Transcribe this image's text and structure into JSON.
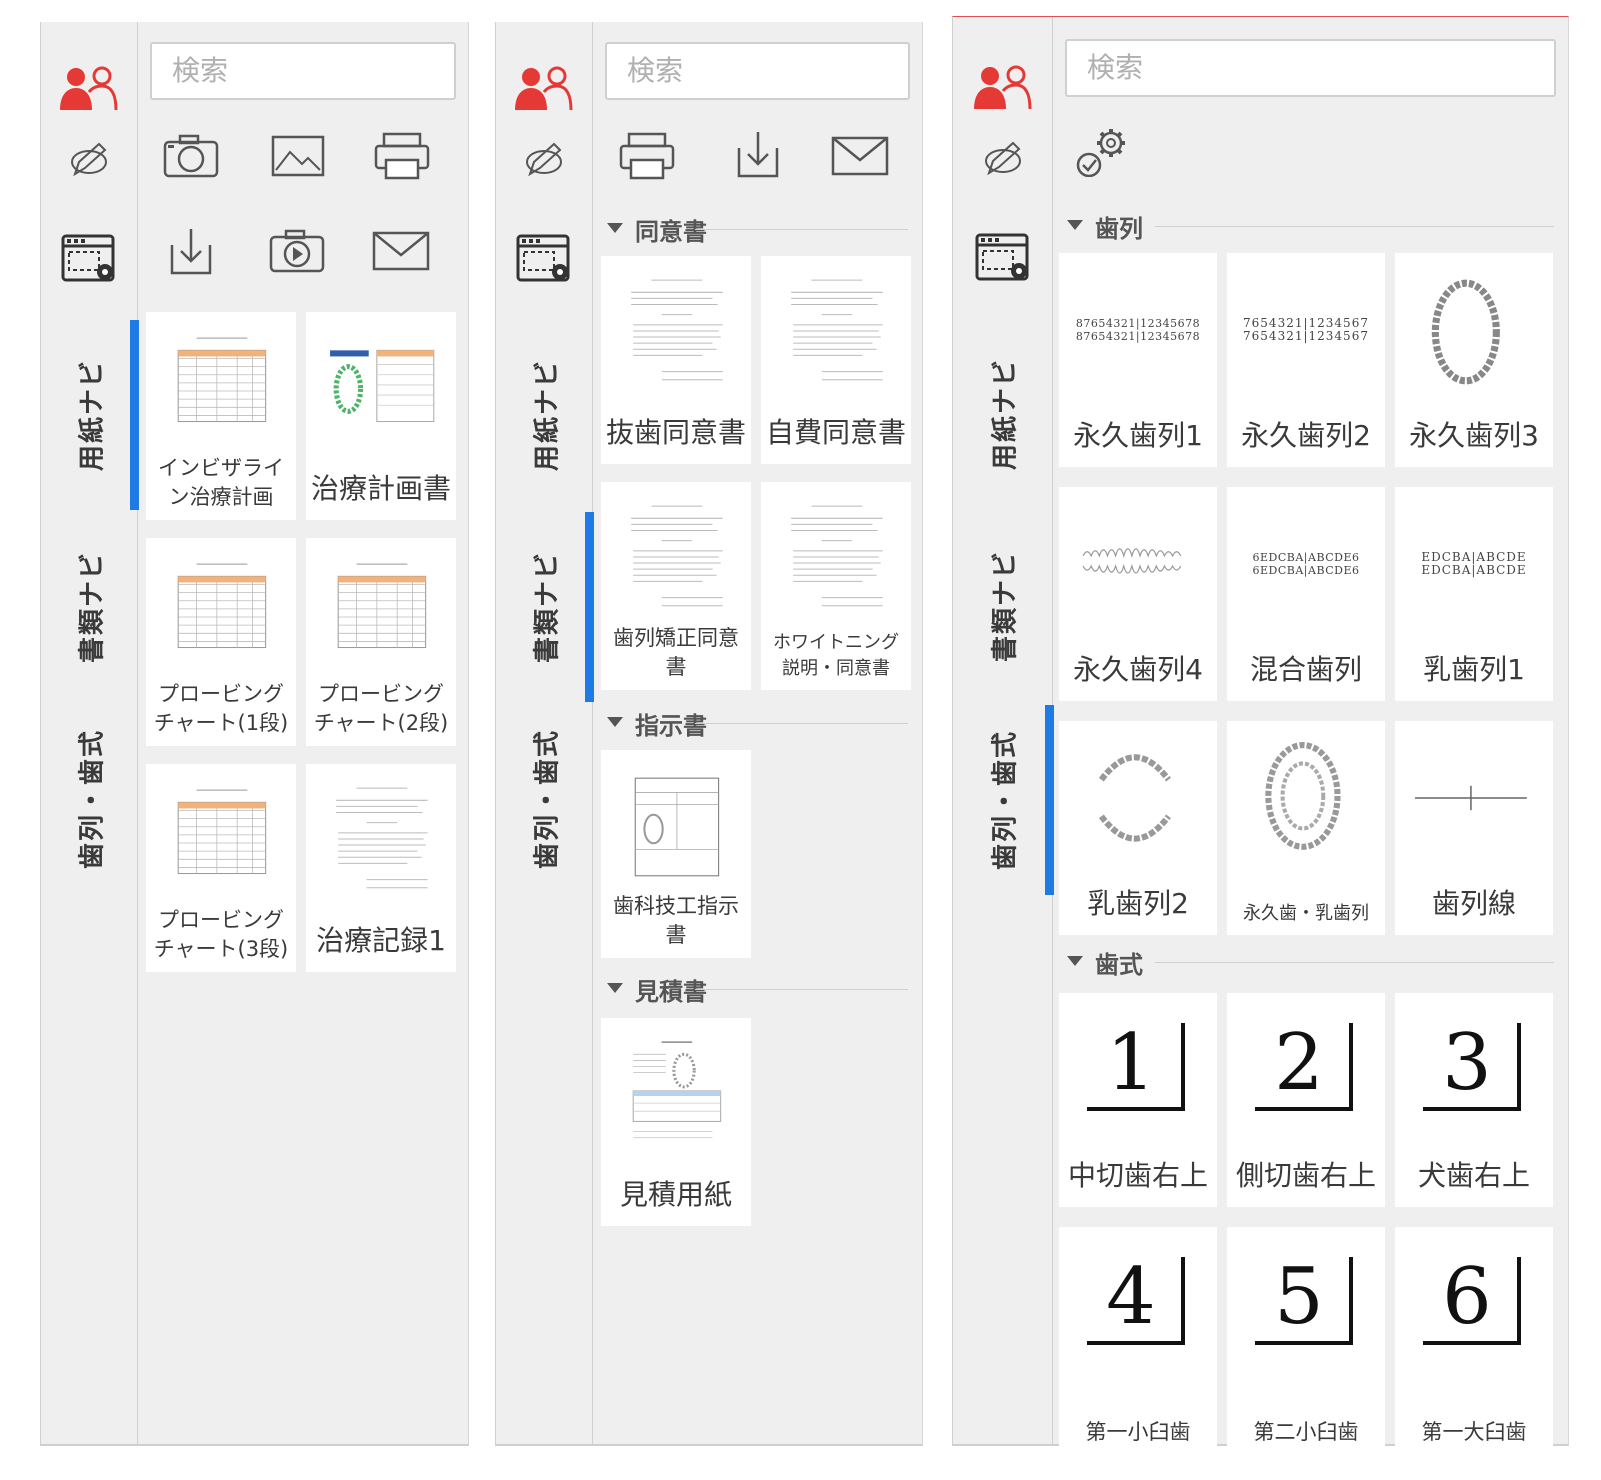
{
  "search_placeholder": "検索",
  "rail_tabs": {
    "paper_navi": "用紙ナビ",
    "document_navi": "書類ナビ",
    "dentition_formula": "歯列・歯式"
  },
  "panel1": {
    "tiles": [
      "インビザライン治療計画",
      "治療計画書",
      "プロービングチャート(1段)",
      "プロービングチャート(2段)",
      "プロービングチャート(3段)",
      "治療記録1"
    ]
  },
  "panel2": {
    "sections": {
      "consent": "同意書",
      "instruction": "指示書",
      "estimate": "見積書"
    },
    "consent_tiles": [
      "抜歯同意書",
      "自費同意書",
      "歯列矯正同意書",
      "ホワイトニング説明・同意書"
    ],
    "instruction_tiles": [
      "歯科技工指示書"
    ],
    "estimate_tiles": [
      "見積用紙"
    ]
  },
  "panel3": {
    "sections": {
      "dentition": "歯列",
      "formula": "歯式"
    },
    "dentition_tiles": [
      "永久歯列1",
      "永久歯列2",
      "永久歯列3",
      "永久歯列4",
      "混合歯列",
      "乳歯列1",
      "乳歯列2",
      "永久歯・乳歯列",
      "歯列線"
    ],
    "formula_tiles": [
      "中切歯右上",
      "側切歯右上",
      "犬歯右上",
      "第一小臼歯",
      "第二小臼歯",
      "第一大臼歯"
    ],
    "formula_numbers": [
      "1",
      "2",
      "3",
      "4",
      "5",
      "6"
    ],
    "dentition_codes": {
      "d1": "87654321|12345678",
      "d2": "7654321|1234567",
      "mixed": "6EDCBA|ABCDE6",
      "primary": "EDCBA|ABCDE"
    }
  },
  "colors": {
    "accent": "#1e7be6",
    "brand_red": "#e53935",
    "panel_bg": "#efefef"
  }
}
